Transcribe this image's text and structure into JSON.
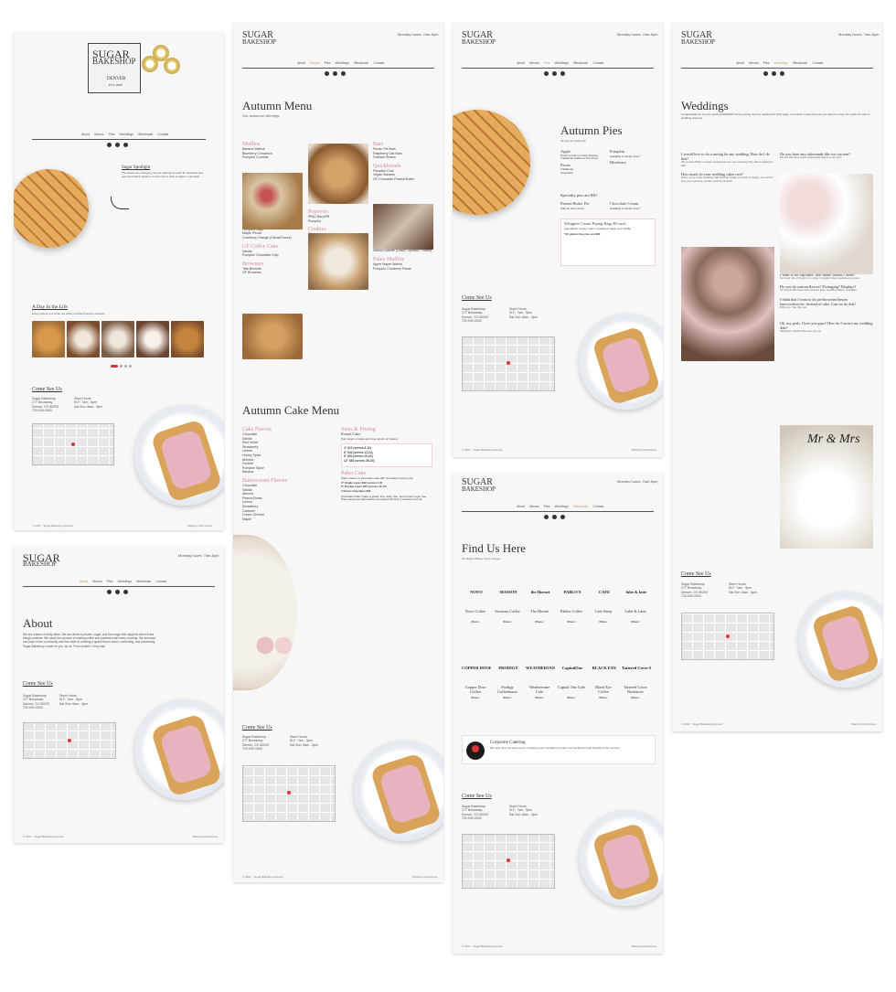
{
  "common": {
    "logo_line1": "SUGAR",
    "logo_line2": "BAKESHOP",
    "hours": "Monday hours: 7am-5pm",
    "nav": [
      "About",
      "Menus",
      "Pies",
      "Weddings",
      "Wholesale",
      "Contact"
    ],
    "come_see_us": "Come See Us",
    "address": "Sugar Bakeshop\n277 Broadway\nDenver, CO 80203\n720-000-0000",
    "store_hours": "Store Hours\nM-F: 7am - 5pm\nSat Sun: 8am - 5pm",
    "footer_left": "© 2017 - Sugar Bakeshop Denver",
    "footer_right": "Made by Red Frame"
  },
  "home": {
    "sign_line1": "SUGAR",
    "sign_line2": "BAKESHOP",
    "sign_city": "DENVER",
    "sign_est": "EST. 2008",
    "spotlight_title": "Sugar Spotlight",
    "spotlight_text": "The leaves are changing, we are starting to reach for sweaters and pies are back in season. Come in for a slice of apple or pumpkin.",
    "life_title": "A Day In the Life",
    "life_text": "Every picture is a smile, we share our life through a camera."
  },
  "about": {
    "title": "About",
    "text": "We are a team of early risers. We are driven by butter, sugar, and the magic that happens when those things combine. We value the process of making coffee and pastries fresh every morning. We embrace our place in the community and find value in creating a space that is warm, comforting, and welcoming. Sugar Bakeshop: made for you, by us. From scratch. Every day."
  },
  "autumn_menu": {
    "title": "Autumn Menu",
    "subtitle": "Our seasonal offerings.",
    "left_sections": [
      {
        "name": "Muffins",
        "items": [
          "Banana Walnut",
          "Blueberry Cinnamon",
          "Pumpkin Crumble"
        ]
      },
      {
        "name": "Scones",
        "items": [
          "Pumpkin Sage",
          "Maple Pecan",
          "Cranberry Orange (Citrus/Cloves)"
        ]
      },
      {
        "name": "GF Coffee Cake",
        "items": [
          "Vanilla",
          "Pumpkin Chocolate Chip"
        ]
      },
      {
        "name": "Brownies",
        "items": [
          "Tate Brownie",
          "GF Brownies"
        ]
      },
      {
        "name": "4\" Cheesecake",
        "items": [
          "Caramel Apple Cheesecake w/ Crumble Topping",
          "Vanilla w/ Graham Cracker Crust"
        ]
      }
    ],
    "mid_sections": [
      {
        "name": "Popovers",
        "items": [
          "PB&J Burp/PB",
          "Pumpkin"
        ]
      },
      {
        "name": "Cookies",
        "items": [
          "S'mores",
          "Nutty Buddies",
          "Maple Snickerdoodle",
          "Vegan Cinnamon Apple Oatmeal",
          "GF Coconut Chocolate Chip"
        ]
      },
      {
        "name": "Brioche",
        "items": [
          "Sticky Pecan Rolls (Honey Glaze)",
          "Cinnamon Sugar",
          "Apple Fools"
        ]
      }
    ],
    "right_sections": [
      {
        "name": "Bars",
        "items": [
          "Pecan Pie Bars",
          "Raspberry Oat Bars",
          "Graham Shaws"
        ]
      },
      {
        "name": "Quickbreads",
        "items": [
          "Pumpkin Chai",
          "Vegan Banana",
          "GF Chocolate Peanut Butter"
        ]
      },
      {
        "name": "Case Desserts",
        "items": [
          "Pumpkin Whoopie w/ Cream Cheese Frosting",
          "Mini Pies (Pumpkin, Pecan, Apple)",
          "Savory Galette (Onion, Spinach, Potato)"
        ]
      },
      {
        "name": "Paleo Muffins",
        "items": [
          "Apple Maple Walnut",
          "Pumpkin Cranberry Pecan"
        ]
      }
    ],
    "cake_title": "Autumn Cake Menu",
    "cake_flavors_title": "Cake Flavors",
    "cake_flavors": [
      "Chocolate",
      "Vanilla",
      "Red Velvet",
      "Strawberry",
      "Lemon",
      "Honey Spice",
      "Almond",
      "Funfetti",
      "Pumpkin Spice",
      "Banana"
    ],
    "buttercream_title": "Buttercream Flavors",
    "buttercream": [
      "Chocolate",
      "Vanilla",
      "Almond",
      "Peanut Butter",
      "Lemon",
      "Strawberry",
      "Caramel",
      "Cream Cheese",
      "Maple"
    ],
    "sizes_title": "Sizes & Pricing",
    "round_cake": "Round Cake",
    "round_text": "Four layers of cake and three layers of frosting",
    "prices": [
      "4\" $12 (serves 6-10)",
      "6\" $42 (serves 12-14)",
      "8\" $52 (serves 20-24)",
      "12\" $62 (serves 36-40)"
    ],
    "paleo_title": "Paleo Cake",
    "paleo_text": "Paleo Cake is a chocolate cake with chocolate frosting only",
    "paleo_prices": [
      "4\" Single Layer $22 (serves 4-6)",
      "6\" Double Layer $45 (serves 10-12)",
      "1 Dozen Cupcakes $36"
    ],
    "paleo_note": "Chocolate Paleo Cake is gluten free, dairy free, and refined sugar free. Paleo approved decorations are glazed almond or toasted coconut."
  },
  "pies": {
    "title": "Autumn Pies",
    "subtitle": "All pies are $20 each",
    "apple": "Apple",
    "apple_text": "Dutch w/ Oat Crumble Topping\nTraditional Lattice w/ Pie Crust",
    "pumpkin": "Pumpkin",
    "pumpkin_text": "Available in Gluten Free*",
    "blueberry": "Blueberry",
    "pecan": "Pecan",
    "pecan_text": "Traditional\nChocolate",
    "specialty": "Specialty pies are $30",
    "pb_pie": "Peanut Butter Pie",
    "pb_text": "With an Oreo Crust",
    "choc_cream": "Chocolate Cream",
    "choc_text": "Available in Gluten Free*",
    "piping_title": "Whipped Cream Piping Bags $5 each",
    "piping_text": "Ingredients: heavy cream, powdered sugar, and vanilla",
    "gf_note": "*All gluten-free pies are $30"
  },
  "find": {
    "title": "Find Us Here",
    "subtitle": "No Matter Where You're Hungry",
    "row1": [
      {
        "logo": "NOVO",
        "name": "Novo Coffee",
        "where": "Where:"
      },
      {
        "logo": "SESSION",
        "name": "Sessions Coffee",
        "where": "Where:"
      },
      {
        "logo": "the Hornet",
        "name": "The Hornet",
        "where": "Where:"
      },
      {
        "logo": "PABLO'S",
        "name": "Pablos Coffee",
        "where": "Where:"
      },
      {
        "logo": "CAFE",
        "name": "Cafe Steep",
        "where": "Where:"
      },
      {
        "logo": "lube & latte",
        "name": "Lube & Latte",
        "where": "Where:"
      }
    ],
    "row2": [
      {
        "logo": "COPPER DOOR",
        "name": "Copper Door Coffee",
        "where": "Where:"
      },
      {
        "logo": "PRODIGY",
        "name": "Prodigy Coffeehouse",
        "where": "Where:"
      },
      {
        "logo": "WEATHERVANE",
        "name": "Weathervane Cafe",
        "where": "Where:"
      },
      {
        "logo": "CapitalOne",
        "name": "Capital One Cafe",
        "where": "Where:"
      },
      {
        "logo": "BLACK EYE",
        "name": "Black Eye Coffee",
        "where": "Where:"
      },
      {
        "logo": "Tattered Cover Book Store",
        "name": "Tattered Cover Bookstore",
        "where": "Where:"
      }
    ],
    "catering_title": "Corporate Catering",
    "catering_text": "We cater all of the best events, including yours! All catering orders are handled through Foodsie at the moment."
  },
  "weddings": {
    "title": "Weddings",
    "intro": "Congratulations! You are getting MARRIED! How exciting. And by reading this FAQ page, it certainly means that you are about to enjoy the really fun part of wedding planning.",
    "faq_left": [
      {
        "q": "I would love to do a tasting for my wedding. How do I do that?",
        "a": "We would LOVE to create a tasting box for your wedding! We offer a tasting for $35."
      },
      {
        "q": "How much do your wedding cakes cost?",
        "a": "Since every single wedding cake that we create is a custom design, we cannot give you a precise number until we sit down."
      },
      {
        "q": "Do you deliver? Offer setup?",
        "a": "We sure do! We're happy to deliver and/or setup your wedding dessert of choice."
      },
      {
        "q": "Do you deliver all the way to the mountains?",
        "a": "We have happily driven all over the mountain roads to get the cake there on time."
      }
    ],
    "faq_right": [
      {
        "q": "Do you have any cakestands like we can rent?",
        "a": "We do! We have a few cakestands that you can rent."
      },
      {
        "q": "I want to do cupcakes, how many should I order?",
        "a": "Our best rule of thumb is to order 1 regular sized cupcake per guest."
      },
      {
        "q": "Do you do custom flavors? Packaging? Displays?",
        "a": "Of course! We have done dessert bars, wedding cakes, cupcakes."
      },
      {
        "q": "I think that I want to do pie/brownies/lemon bars/cookies/etc. instead of cake. Can we do that?",
        "a": "Why, yes. Yes. We can."
      },
      {
        "q": "Oh, my gosh, I love you guys! How do I secure my wedding date?",
        "a": "Well gosh, thanks! We love you too."
      }
    ],
    "topper_text": "Mr & Mrs"
  }
}
